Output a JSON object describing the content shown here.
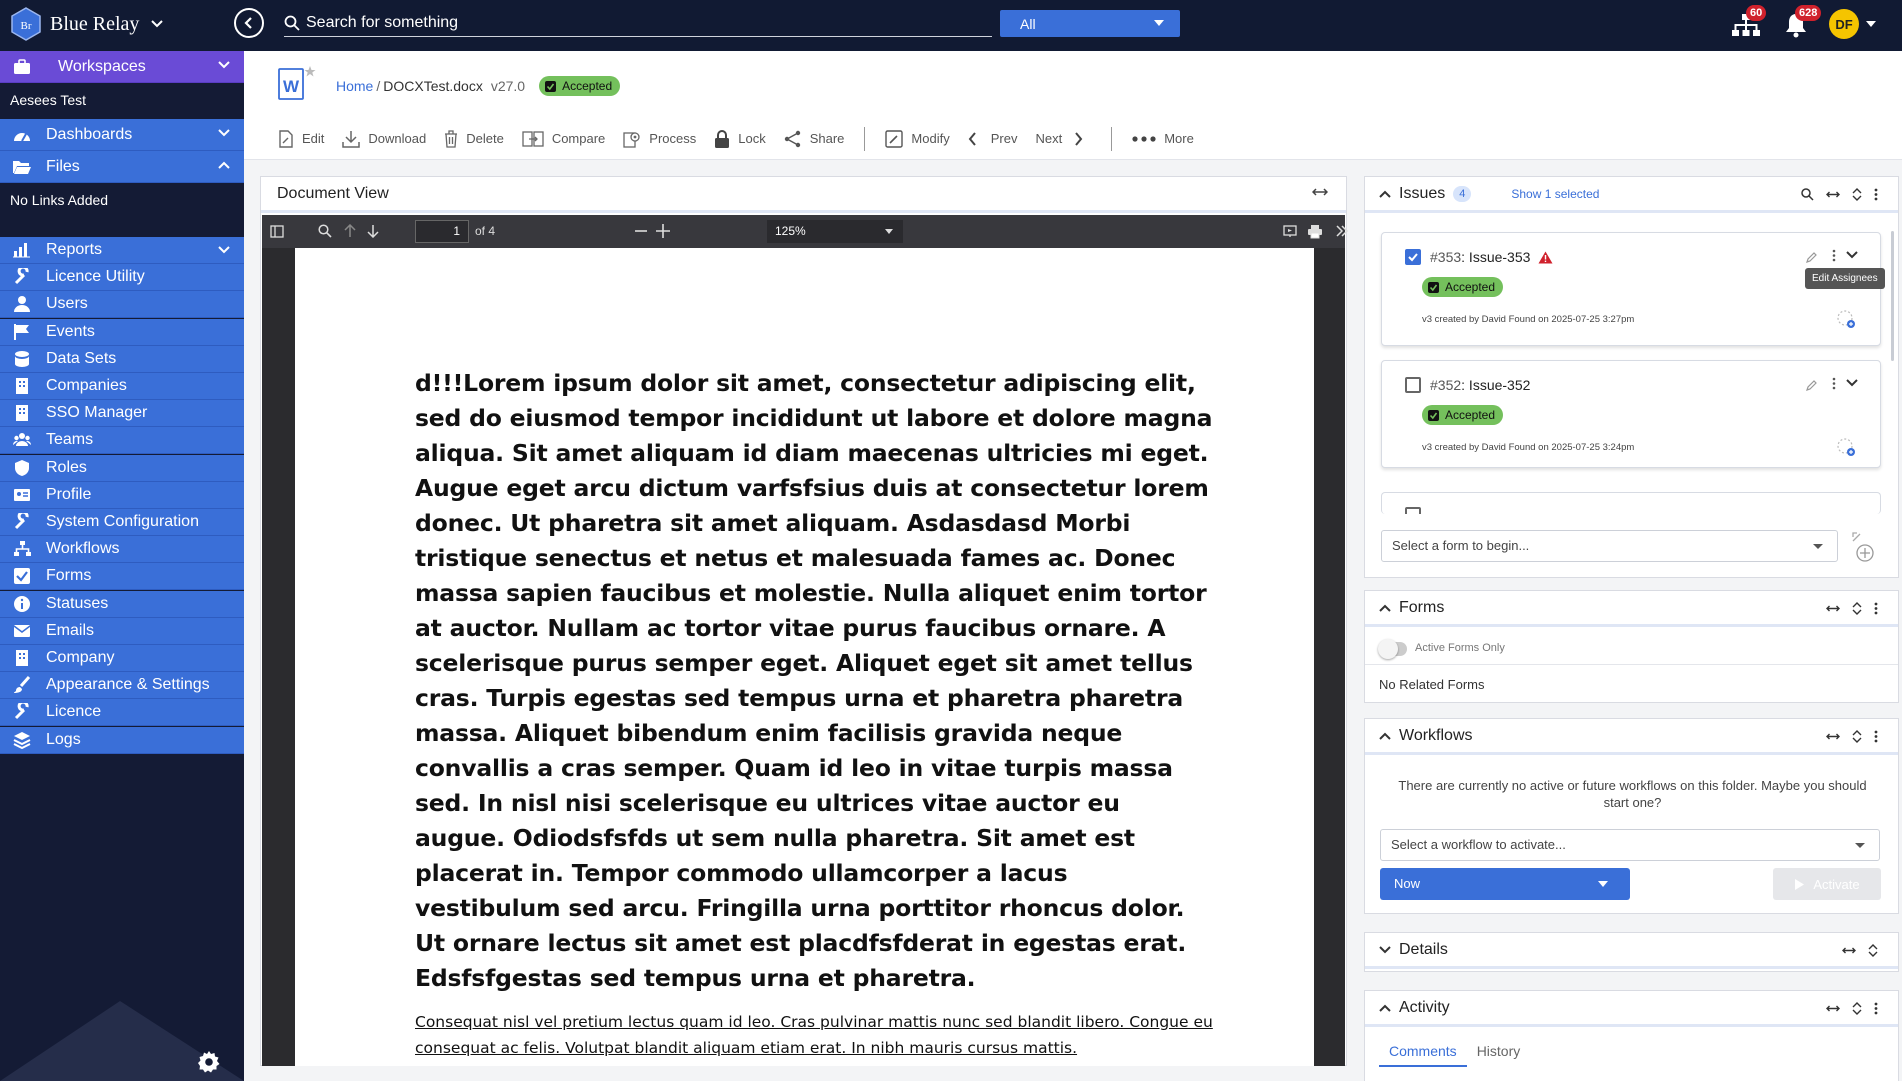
{
  "app": {
    "name": "Blue Relay"
  },
  "topbar": {
    "search_placeholder": "Search for something",
    "scope": "All",
    "tasks_count": "60",
    "notifications_count": "628",
    "user_initials": "DF"
  },
  "sidebar": {
    "workspaces": "Workspaces",
    "workspace_name": "Aesees Test",
    "dashboards": "Dashboards",
    "files": "Files",
    "no_links": "No Links Added",
    "items": [
      "Reports",
      "Licence Utility",
      "Users",
      "Events",
      "Data Sets",
      "Companies",
      "SSO Manager",
      "Teams",
      "Roles",
      "Profile",
      "System Configuration",
      "Workflows",
      "Forms",
      "Statuses",
      "Emails",
      "Company",
      "Appearance & Settings",
      "Licence",
      "Logs"
    ]
  },
  "document": {
    "breadcrumb_home": "Home",
    "breadcrumb_sep": "/",
    "file_name": "DOCXTest.docx",
    "version": "v27.0",
    "status": "Accepted"
  },
  "toolbar": {
    "edit": "Edit",
    "download": "Download",
    "delete": "Delete",
    "compare": "Compare",
    "process": "Process",
    "lock": "Lock",
    "share": "Share",
    "modify": "Modify",
    "prev": "Prev",
    "next": "Next",
    "more": "More"
  },
  "viewer": {
    "title": "Document View",
    "page_current": "1",
    "page_total": "of 4",
    "zoom": "125%",
    "body_bold": "d!!!Lorem ipsum dolor sit amet, consectetur adipiscing elit, sed do eiusmod tempor incididunt ut labore et dolore magna aliqua. Sit amet aliquam id diam maecenas ultricies mi eget. Augue eget arcu dictum varfsfsius duis at consectetur lorem donec. Ut pharetra sit amet aliquam. Asdasdasd Morbi tristique senectus et netus et malesuada fames ac. Donec massa sapien faucibus et molestie. Nulla aliquet enim tortor at auctor. Nullam ac tortor vitae purus faucibus ornare. A scelerisque purus semper eget. Aliquet eget sit amet tellus cras. Turpis egestas sed tempus urna et pharetra pharetra massa. Aliquet bibendum enim facilisis gravida neque convallis a cras semper. Quam id leo in vitae turpis massa sed. In nisl nisi scelerisque eu ultrices vitae auctor eu augue. Odiodsfsfds ut sem nulla pharetra. Sit amet est placerat in. Tempor commodo ullamcorper a lacus vestibulum sed arcu. Fringilla urna porttitor rhoncus dolor. Ut ornare lectus sit amet est placdfsfderat in egestas erat. Edsfsfgestas sed tempus urna et pharetra.",
    "body_light": "Consequat nisl vel pretium lectus quam id leo. Cras pulvinar mattis nunc sed blandit libero. Congue eu consequat ac felis. Volutpat blandit aliquam etiam erat. In nibh mauris cursus mattis."
  },
  "issues": {
    "title": "Issues",
    "count": "4",
    "show_selected": "Show 1 selected",
    "tooltip": "Edit Assignees",
    "items": [
      {
        "num": "#353",
        "name": ": Issue-353",
        "status": "Accepted",
        "meta": "v3 created by David Found on 2025-07-25 3:27pm",
        "checked": true
      },
      {
        "num": "#352",
        "name": ": Issue-352",
        "status": "Accepted",
        "meta": "v3 created by David Found on 2025-07-25 3:24pm",
        "checked": false
      }
    ],
    "form_placeholder": "Select a form to begin..."
  },
  "forms": {
    "title": "Forms",
    "toggle_label": "Active Forms Only",
    "empty": "No Related Forms"
  },
  "workflows": {
    "title": "Workflows",
    "message": "There are currently no active or future workflows on this folder. Maybe you should start one?",
    "select_placeholder": "Select a workflow to activate...",
    "when": "Now",
    "activate": "Activate"
  },
  "details": {
    "title": "Details"
  },
  "activity": {
    "title": "Activity",
    "tabs": [
      "Comments",
      "History"
    ]
  },
  "colors": {
    "topbar": "#111a33",
    "accent": "#3a6fd8",
    "accepted": "#74c05c",
    "badge": "#d0212c"
  }
}
